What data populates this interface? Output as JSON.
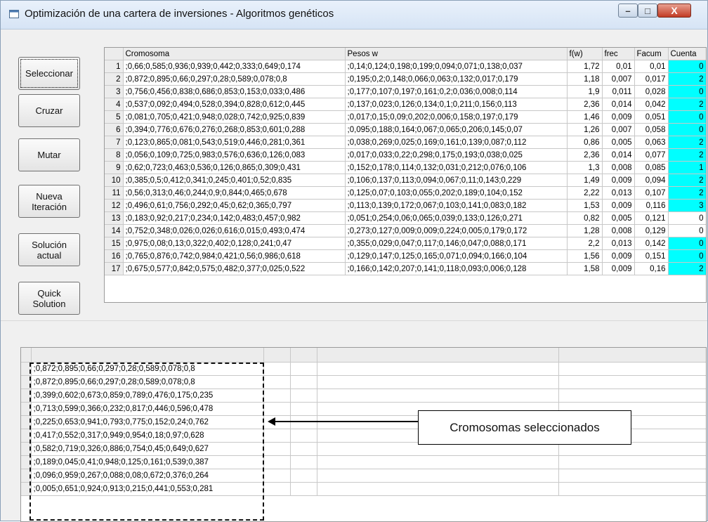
{
  "window": {
    "title": "Optimización de una cartera de inversiones - Algoritmos genéticos",
    "minimize_icon": "minimize-icon",
    "maximize_icon": "maximize-icon",
    "close_icon": "close-icon",
    "min_glyph": "–",
    "max_glyph": "□",
    "close_glyph": "X"
  },
  "buttons": {
    "seleccionar": "Seleccionar",
    "cruzar": "Cruzar",
    "mutar": "Mutar",
    "nueva_iteracion_1": "Nueva",
    "nueva_iteracion_2": "Iteración",
    "solucion_1": "Solución",
    "solucion_2": "actual",
    "quick_1": "Quick",
    "quick_2": "Solution"
  },
  "top_table": {
    "headers": [
      "Cromosoma",
      "Pesos w",
      "f(w)",
      "frec",
      "Facum",
      "Cuenta"
    ],
    "rows": [
      {
        "n": "1",
        "crom": ";0,66;0,585;0,936;0,939;0,442;0,333;0,649;0,174",
        "pesos": ";0,14;0,124;0,198;0,199;0,094;0,071;0,138;0,037",
        "fw": "1,72",
        "frec": "0,01",
        "facum": "0,01",
        "cuenta": "0",
        "cyan": true
      },
      {
        "n": "2",
        "crom": ";0,872;0,895;0,66;0,297;0,28;0,589;0,078;0,8",
        "pesos": ";0,195;0,2;0,148;0,066;0,063;0,132;0,017;0,179",
        "fw": "1,18",
        "frec": "0,007",
        "facum": "0,017",
        "cuenta": "2",
        "cyan": true
      },
      {
        "n": "3",
        "crom": ";0,756;0,456;0,838;0,686;0,853;0,153;0,033;0,486",
        "pesos": ";0,177;0,107;0,197;0,161;0,2;0,036;0,008;0,114",
        "fw": "1,9",
        "frec": "0,011",
        "facum": "0,028",
        "cuenta": "0",
        "cyan": true
      },
      {
        "n": "4",
        "crom": ";0,537;0,092;0,494;0,528;0,394;0,828;0,612;0,445",
        "pesos": ";0,137;0,023;0,126;0,134;0,1;0,211;0,156;0,113",
        "fw": "2,36",
        "frec": "0,014",
        "facum": "0,042",
        "cuenta": "2",
        "cyan": true
      },
      {
        "n": "5",
        "crom": ";0,081;0,705;0,421;0,948;0,028;0,742;0,925;0,839",
        "pesos": ";0,017;0,15;0,09;0,202;0,006;0,158;0,197;0,179",
        "fw": "1,46",
        "frec": "0,009",
        "facum": "0,051",
        "cuenta": "0",
        "cyan": true
      },
      {
        "n": "6",
        "crom": ";0,394;0,776;0,676;0,276;0,268;0,853;0,601;0,288",
        "pesos": ";0,095;0,188;0,164;0,067;0,065;0,206;0,145;0,07",
        "fw": "1,26",
        "frec": "0,007",
        "facum": "0,058",
        "cuenta": "0",
        "cyan": true
      },
      {
        "n": "7",
        "crom": ";0,123;0,865;0,081;0,543;0,519;0,446;0,281;0,361",
        "pesos": ";0,038;0,269;0,025;0,169;0,161;0,139;0,087;0,112",
        "fw": "0,86",
        "frec": "0,005",
        "facum": "0,063",
        "cuenta": "2",
        "cyan": true
      },
      {
        "n": "8",
        "crom": ";0,056;0,109;0,725;0,983;0,576;0,636;0,126;0,083",
        "pesos": ";0,017;0,033;0,22;0,298;0,175;0,193;0,038;0,025",
        "fw": "2,36",
        "frec": "0,014",
        "facum": "0,077",
        "cuenta": "2",
        "cyan": true
      },
      {
        "n": "9",
        "crom": ";0,62;0,723;0,463;0,536;0,126;0,865;0,309;0,431",
        "pesos": ";0,152;0,178;0,114;0,132;0,031;0,212;0,076;0,106",
        "fw": "1,3",
        "frec": "0,008",
        "facum": "0,085",
        "cuenta": "1",
        "cyan": true
      },
      {
        "n": "10",
        "crom": ";0,385;0,5;0,412;0,341;0,245;0,401;0,52;0,835",
        "pesos": ";0,106;0,137;0,113;0,094;0,067;0,11;0,143;0,229",
        "fw": "1,49",
        "frec": "0,009",
        "facum": "0,094",
        "cuenta": "2",
        "cyan": true
      },
      {
        "n": "11",
        "crom": ";0,56;0,313;0,46;0,244;0,9;0,844;0,465;0,678",
        "pesos": ";0,125;0,07;0,103;0,055;0,202;0,189;0,104;0,152",
        "fw": "2,22",
        "frec": "0,013",
        "facum": "0,107",
        "cuenta": "2",
        "cyan": true
      },
      {
        "n": "12",
        "crom": ";0,496;0,61;0,756;0,292;0,45;0,62;0,365;0,797",
        "pesos": ";0,113;0,139;0,172;0,067;0,103;0,141;0,083;0,182",
        "fw": "1,53",
        "frec": "0,009",
        "facum": "0,116",
        "cuenta": "3",
        "cyan": true
      },
      {
        "n": "13",
        "crom": ";0,183;0,92;0,217;0,234;0,142;0,483;0,457;0,982",
        "pesos": ";0,051;0,254;0,06;0,065;0,039;0,133;0,126;0,271",
        "fw": "0,82",
        "frec": "0,005",
        "facum": "0,121",
        "cuenta": "0",
        "cyan": false
      },
      {
        "n": "14",
        "crom": ";0,752;0,348;0,026;0,026;0,616;0,015;0,493;0,474",
        "pesos": ";0,273;0,127;0,009;0,009;0,224;0,005;0,179;0,172",
        "fw": "1,28",
        "frec": "0,008",
        "facum": "0,129",
        "cuenta": "0",
        "cyan": false
      },
      {
        "n": "15",
        "crom": ";0,975;0,08;0,13;0,322;0,402;0,128;0,241;0,47",
        "pesos": ";0,355;0,029;0,047;0,117;0,146;0,047;0,088;0,171",
        "fw": "2,2",
        "frec": "0,013",
        "facum": "0,142",
        "cuenta": "0",
        "cyan": true
      },
      {
        "n": "16",
        "crom": ";0,765;0,876;0,742;0,984;0,421;0,56;0,986;0,618",
        "pesos": ";0,129;0,147;0,125;0,165;0,071;0,094;0,166;0,104",
        "fw": "1,56",
        "frec": "0,009",
        "facum": "0,151",
        "cuenta": "0",
        "cyan": true
      },
      {
        "n": "17",
        "crom": ";0,675;0,577;0,842;0,575;0,482;0,377;0,025;0,522",
        "pesos": ";0,166;0,142;0,207;0,141;0,118;0,093;0,006;0,128",
        "fw": "1,58",
        "frec": "0,009",
        "facum": "0,16",
        "cuenta": "2",
        "cyan": true
      }
    ]
  },
  "bottom_table": {
    "rows": [
      ";0,872;0,895;0,66;0,297;0,28;0,589;0,078;0,8",
      ";0,872;0,895;0,66;0,297;0,28;0,589;0,078;0,8",
      ";0,399;0,602;0,673;0,859;0,789;0,476;0,175;0,235",
      ";0,713;0,599;0,366;0,232;0,817;0,446;0,596;0,478",
      ";0,225;0,653;0,941;0,793;0,775;0,152;0,24;0,762",
      ";0,417;0,552;0,317;0,949;0,954;0,18;0,97;0,628",
      ";0,582;0,719;0,326;0,886;0,754;0,45;0,649;0,627",
      ";0,189;0,045;0,41;0,948;0,125;0,161;0,539;0,387",
      ";0,096;0,959;0,267;0,088;0,08;0,672;0,376;0,264",
      ";0,005;0,651;0,924;0,913;0,215;0,441;0,553;0,281"
    ]
  },
  "callout": {
    "text": "Cromosomas seleccionados"
  },
  "colors": {
    "highlight_cell": "#00ffff"
  }
}
